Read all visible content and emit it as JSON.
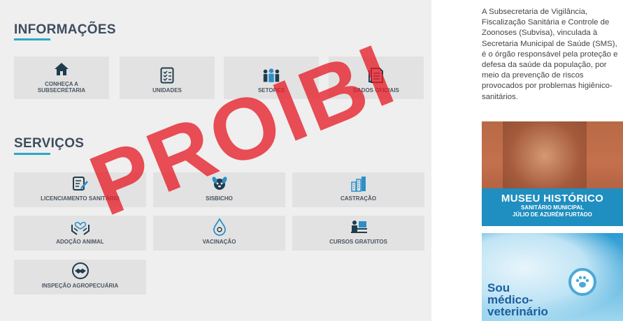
{
  "informacoes": {
    "title": "INFORMAÇÕES",
    "tiles": [
      {
        "label": "CONHEÇA A SUBSECRETARIA",
        "icon": "home-icon"
      },
      {
        "label": "UNIDADES",
        "icon": "checklist-icon"
      },
      {
        "label": "SETORES",
        "icon": "people-icon"
      },
      {
        "label": "DADOS OFICIAIS",
        "icon": "document-icon"
      }
    ]
  },
  "servicos": {
    "title": "SERVIÇOS",
    "tiles": [
      {
        "label": "LICENCIAMENTO SANITÁRIO",
        "icon": "edit-document-icon"
      },
      {
        "label": "SISBICHO",
        "icon": "dog-icon"
      },
      {
        "label": "CASTRAÇÃO",
        "icon": "buildings-icon"
      },
      {
        "label": "ADOÇÃO ANIMAL",
        "icon": "heart-hands-icon"
      },
      {
        "label": "VACINAÇÃO",
        "icon": "vaccine-drop-icon"
      },
      {
        "label": "CURSOS GRATUITOS",
        "icon": "person-computer-icon"
      },
      {
        "label": "INSPEÇÃO AGROPECUÁRIA",
        "icon": "handshake-icon"
      }
    ]
  },
  "watermark": "PROIBI",
  "sidebar": {
    "description": "A Subsecretaria de Vigilância, Fiscalização Sanitária e Controle de Zoonoses (Subvisa), vinculada à Secretaria Municipal de Saúde (SMS), é o órgão responsável pela proteção e defesa da saúde da população, por meio da prevenção de riscos provocados por problemas higiênico-sanitários.",
    "museu_title": "MUSEU HISTÓRICO",
    "museu_sub1": "SANITÁRIO MUNICIPAL",
    "museu_sub2": "JÚLIO DE AZURÉM FURTADO",
    "vet_line1": "Sou",
    "vet_line2": "médico-",
    "vet_line3": "veterinário"
  },
  "colors": {
    "accent": "#2aa8c4",
    "title": "#3e4d5f",
    "tile_bg": "#e2e2e2",
    "panel_bg": "#efefef",
    "icon_dark": "#1f3d4f",
    "icon_blue": "#2d8fc9",
    "watermark": "#e61e28"
  }
}
